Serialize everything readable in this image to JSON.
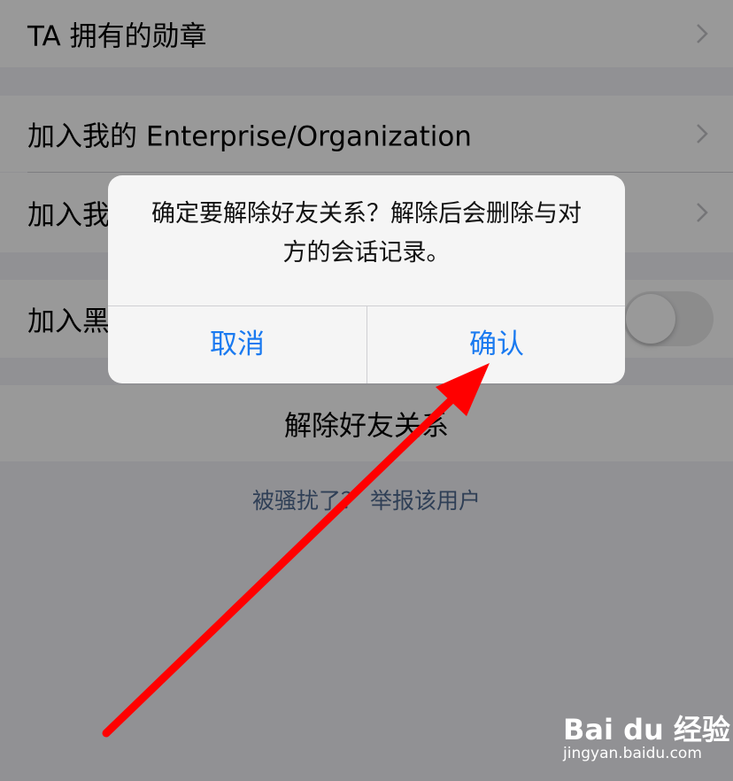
{
  "settings": {
    "badges_label": "TA 拥有的勋章",
    "enterprise_label": "加入我的 Enterprise/Organization",
    "join_my_partial": "加入我",
    "blacklist_partial": "加入黑",
    "blacklist_on": false,
    "unfriend_label": "解除好友关系",
    "report_label": "被骚扰了？ 举报该用户"
  },
  "dialog": {
    "message": "确定要解除好友关系？解除后会删除与对方的会话记录。",
    "cancel_label": "取消",
    "confirm_label": "确认",
    "accent_color": "#1a7af0"
  },
  "annotation": {
    "arrow_color": "#ff0000"
  },
  "watermark": {
    "logo_text": "Bai du 经验",
    "url": "jingyan.baidu.com"
  }
}
